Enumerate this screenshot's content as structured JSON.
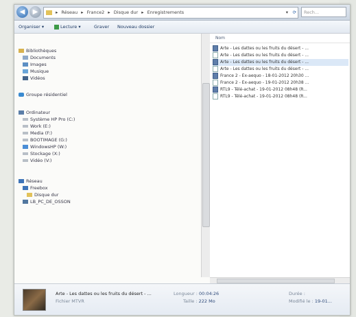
{
  "window": {
    "breadcrumb": [
      "Réseau",
      "France2",
      "Disque dur",
      "Enregistrements"
    ],
    "search_placeholder": "Rech..."
  },
  "toolbar": {
    "organize": "Organiser ▾",
    "read": "Lecture ▾",
    "burn": "Graver",
    "new_folder": "Nouveau dossier"
  },
  "sidebar": {
    "libraries": "Bibliothèques",
    "documents": "Documents",
    "images": "Images",
    "music": "Musique",
    "videos": "Vidéos",
    "homegroup": "Groupe résidentiel",
    "computer": "Ordinateur",
    "drives": [
      "Système HP Pro (C:)",
      "Work (E:)",
      "Media (F:)",
      "BOOTIMAGE (G:)",
      "WindowsHP (W:)",
      "Stockage (X:)",
      "Vidéo (V:)"
    ],
    "network": "Réseau",
    "network_sub": "Freebox",
    "network_folder": "Disque dur",
    "network_pc": "LB_PC_DE_OSSON"
  },
  "files": {
    "column": "Nom",
    "items": [
      "Arte - Les dattes ou les fruits du désert - ...",
      "Arte - Les dattes ou les fruits du désert - ...",
      "Arte - Les dattes ou les fruits du désert - ...",
      "Arte - Les dattes ou les fruits du désert - ...",
      "France 2 - Ex-aequo - 18-01-2012 20h30 ...",
      "France 2 - Ex-aequo - 19-01-2012 20h38 ...",
      "RTL9 - Télé-achat - 19-01-2012 08h48 (R...",
      "RTL9 - Télé-achat - 19-01-2012 08h48 (R..."
    ]
  },
  "details": {
    "title": "Arte - Les dattes ou les fruits du désert - ...",
    "type": "Fichier MTVR",
    "length_label": "Longueur :",
    "length_value": "00:04:26",
    "size_label": "Taille :",
    "size_value": "222 Mo",
    "extra1_label": "Durée :",
    "extra2_label": "Modifié le :",
    "extra2_value": "19-01..."
  }
}
